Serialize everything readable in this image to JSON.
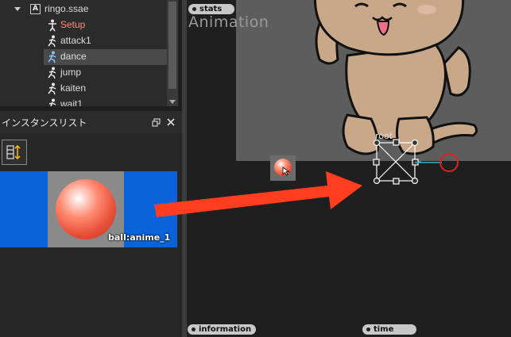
{
  "tree": {
    "root_badge": "A",
    "root_label": "ringo.ssae",
    "items": [
      {
        "label": "Setup",
        "type": "setup"
      },
      {
        "label": "attack1",
        "type": "anim"
      },
      {
        "label": "dance",
        "type": "anim",
        "selected": true
      },
      {
        "label": "jump",
        "type": "anim"
      },
      {
        "label": "kaiten",
        "type": "anim"
      },
      {
        "label": "wait1",
        "type": "anim"
      }
    ]
  },
  "instance_list": {
    "title": "インスタンスリスト",
    "item_label": "ball:anime_1"
  },
  "viewport": {
    "tab_stats": "stats",
    "title": "Animation",
    "root_label": "root",
    "tab_information": "information",
    "tab_time": "time"
  },
  "colors": {
    "selection_blue": "#0a63d8",
    "arrow_red": "#ff3d1f",
    "highlight_red": "#e02020"
  }
}
